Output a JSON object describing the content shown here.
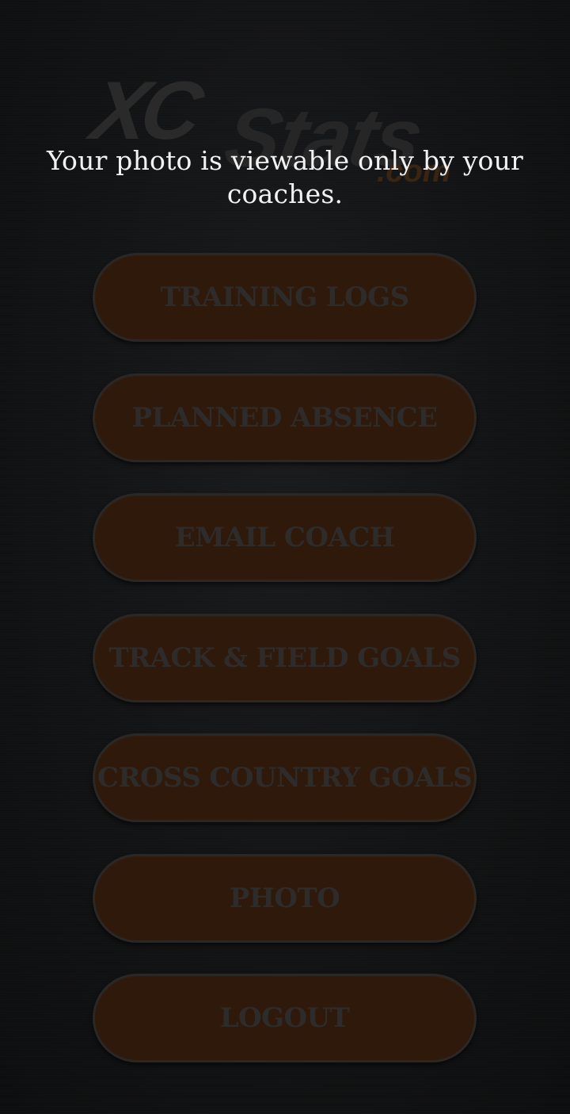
{
  "logo": {
    "xc": "XC",
    "stats": "Stats",
    "com": ".com"
  },
  "message": "Your photo is viewable only by your coaches.",
  "menu": {
    "items": [
      {
        "id": "training-logs",
        "label": "TRAINING LOGS"
      },
      {
        "id": "planned-absence",
        "label": "PLANNED ABSENCE"
      },
      {
        "id": "email-coach",
        "label": "EMAIL COACH"
      },
      {
        "id": "track-field-goals",
        "label": "TRACK & FIELD GOALS"
      },
      {
        "id": "cross-country-goals",
        "label": "CROSS COUNTRY GOALS"
      },
      {
        "id": "photo",
        "label": "PHOTO"
      },
      {
        "id": "logout",
        "label": "LOGOUT"
      }
    ]
  },
  "colors": {
    "background": "#101112",
    "button_fill": "#2e190b",
    "button_text": "#2e2c2a",
    "message_text": "#f2f2f2"
  }
}
